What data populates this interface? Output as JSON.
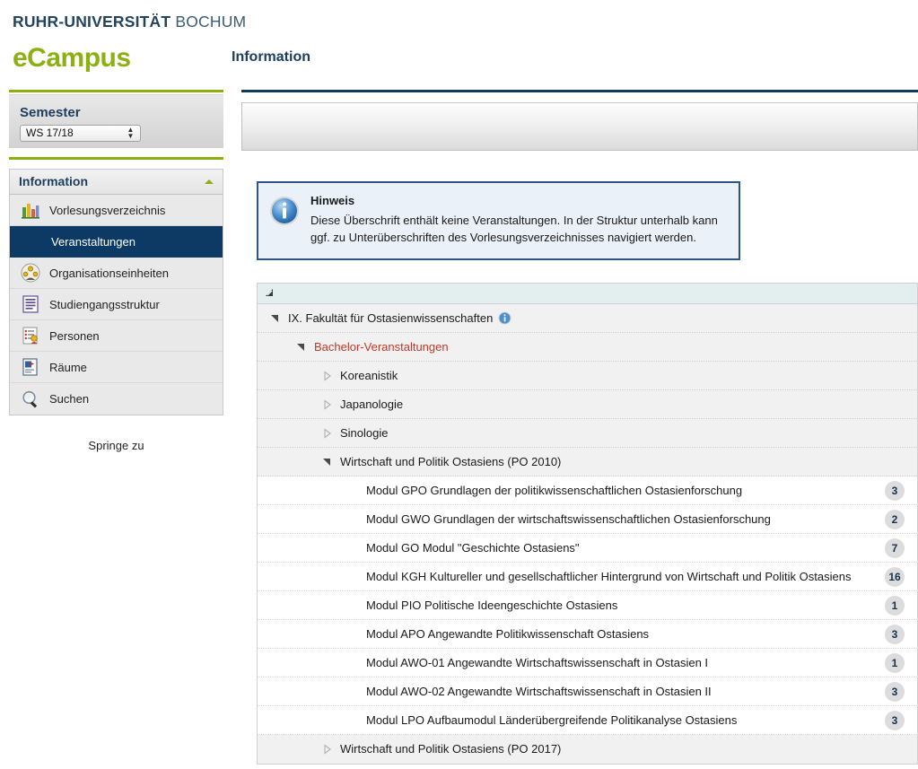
{
  "header": {
    "brand_bold": "RUHR-UNIVERSITÄT",
    "brand_light": "BOCHUM",
    "logo": "eCampus",
    "page_title": "Information"
  },
  "sidebar": {
    "semester": {
      "title": "Semester",
      "selected": "WS 17/18"
    },
    "nav_header": "Information",
    "items": [
      {
        "label": "Vorlesungsverzeichnis",
        "icon": "bar-chart-icon",
        "selected": false
      },
      {
        "label": "Veranstaltungen",
        "icon": "none",
        "selected": true
      },
      {
        "label": "Organisationseinheiten",
        "icon": "people-group-icon",
        "selected": false
      },
      {
        "label": "Studiengangsstruktur",
        "icon": "document-lines-icon",
        "selected": false
      },
      {
        "label": "Personen",
        "icon": "person-list-icon",
        "selected": false
      },
      {
        "label": "Räume",
        "icon": "room-icon",
        "selected": false
      },
      {
        "label": "Suchen",
        "icon": "magnifier-icon",
        "selected": false
      }
    ],
    "jump_to": "Springe zu"
  },
  "notice": {
    "title": "Hinweis",
    "text": "Diese Überschrift enthält keine Veranstaltungen. In der Struktur unterhalb kann ggf. zu Unterüberschriften des Vorlesungsverzeichnisses navigiert werden."
  },
  "tree": {
    "collapse_all_icon": "collapse-all-icon",
    "rows": [
      {
        "label": "IX. Fakultät für Ostasienwissenschaften",
        "indent": 0,
        "state": "expanded",
        "kind": "node",
        "info_icon": true,
        "count": ""
      },
      {
        "label": "Bachelor-Veranstaltungen",
        "indent": 1,
        "state": "expanded",
        "kind": "node",
        "red": true,
        "count": ""
      },
      {
        "label": "Koreanistik",
        "indent": 2,
        "state": "collapsed",
        "kind": "node",
        "count": ""
      },
      {
        "label": "Japanologie",
        "indent": 2,
        "state": "collapsed",
        "kind": "node",
        "count": ""
      },
      {
        "label": "Sinologie",
        "indent": 2,
        "state": "collapsed",
        "kind": "node",
        "count": ""
      },
      {
        "label": "Wirtschaft und Politik Ostasiens (PO 2010)",
        "indent": 2,
        "state": "expanded",
        "kind": "node",
        "count": ""
      },
      {
        "label": "Modul GPO Grundlagen der politikwissenschaftlichen Ostasienforschung",
        "indent": 3,
        "state": "none",
        "kind": "leaf",
        "count": "3"
      },
      {
        "label": "Modul GWO Grundlagen der wirtschaftswissenschaftlichen Ostasienforschung",
        "indent": 3,
        "state": "none",
        "kind": "leaf",
        "count": "2"
      },
      {
        "label": "Modul GO Modul \"Geschichte Ostasiens\"",
        "indent": 3,
        "state": "none",
        "kind": "leaf",
        "count": "7"
      },
      {
        "label": "Modul KGH Kultureller und gesellschaftlicher Hintergrund von Wirtschaft und Politik Ostasiens",
        "indent": 3,
        "state": "none",
        "kind": "leaf",
        "count": "16"
      },
      {
        "label": "Modul PIO Politische Ideengeschichte Ostasiens",
        "indent": 3,
        "state": "none",
        "kind": "leaf",
        "count": "1"
      },
      {
        "label": "Modul APO Angewandte Politikwissenschaft Ostasiens",
        "indent": 3,
        "state": "none",
        "kind": "leaf",
        "count": "3"
      },
      {
        "label": "Modul AWO-01 Angewandte Wirtschaftswissenschaft in Ostasien I",
        "indent": 3,
        "state": "none",
        "kind": "leaf",
        "count": "1"
      },
      {
        "label": "Modul AWO-02 Angewandte Wirtschaftswissenschaft in Ostasien II",
        "indent": 3,
        "state": "none",
        "kind": "leaf",
        "count": "3"
      },
      {
        "label": "Modul LPO Aufbaumodul Länderübergreifende Politikanalyse Ostasiens",
        "indent": 3,
        "state": "none",
        "kind": "leaf",
        "count": "3"
      },
      {
        "label": "Wirtschaft und Politik Ostasiens (PO 2017)",
        "indent": 2,
        "state": "collapsed",
        "kind": "node",
        "count": ""
      }
    ]
  },
  "colors": {
    "brand_green": "#8cb011",
    "brand_navy": "#1c3d5e",
    "selected_nav": "#0d3a65",
    "notice_border": "#2e5685",
    "notice_bg": "#eaf1f9",
    "red_label": "#c0392b",
    "badge_bg": "#dcdcdc"
  }
}
